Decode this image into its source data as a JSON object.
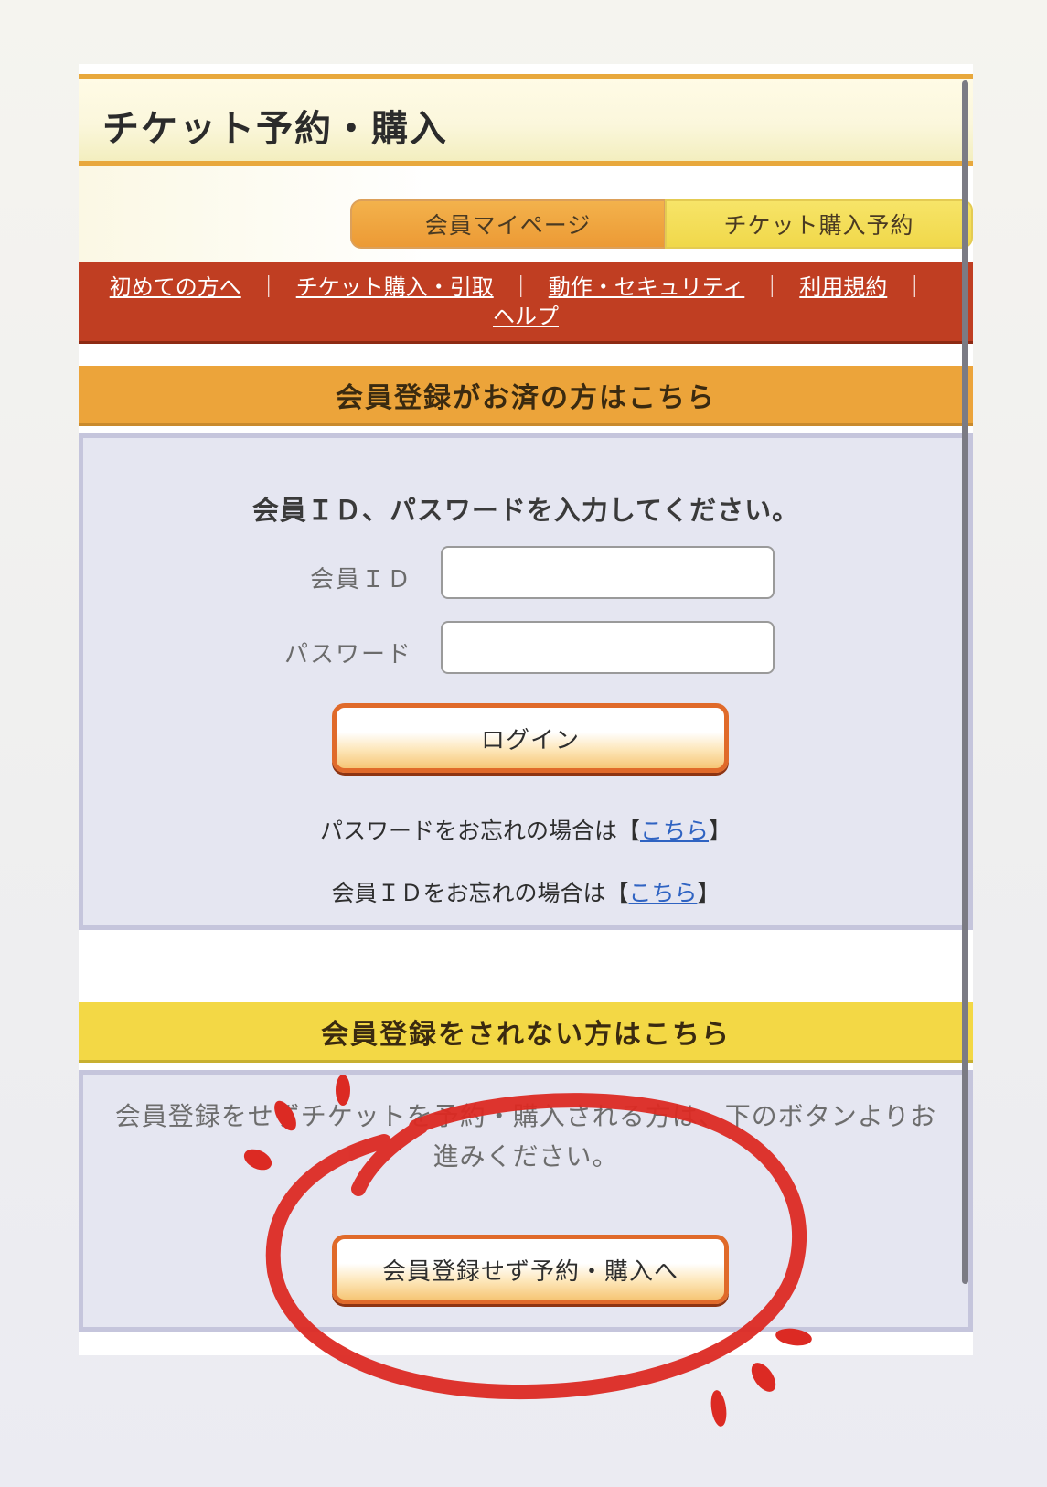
{
  "header": {
    "title": "チケット予約・購入"
  },
  "tabs": [
    {
      "label": "会員マイページ"
    },
    {
      "label": "チケット購入予約"
    }
  ],
  "nav": {
    "items": [
      "初めての方へ",
      "チケット購入・引取",
      "動作・セキュリティ",
      "利用規約",
      "ヘルプ"
    ],
    "separator": "｜"
  },
  "member_section": {
    "header": "会員登録がお済の方はこちら",
    "instruction": "会員ＩＤ、パスワードを入力してください。",
    "id_label": "会員ＩＤ",
    "password_label": "パスワード",
    "id_value": "",
    "password_value": "",
    "login_button": "ログイン",
    "forgot_password_prefix": "パスワードをお忘れの場合は【",
    "forgot_id_prefix": "会員ＩＤをお忘れの場合は【",
    "link_text": "こちら",
    "link_suffix": "】"
  },
  "guest_section": {
    "header": "会員登録をされない方はこちら",
    "description": "会員登録をせずチケットを予約・購入される方は、下のボタンよりお進みください。",
    "button": "会員登録せず予約・購入へ"
  },
  "colors": {
    "title_border": "#e8a83c",
    "nav_bg": "#c03e22",
    "header_orange": "#eca43a",
    "header_yellow": "#f3d845",
    "panel_bg": "#e5e6f1",
    "button_border": "#e06a2a",
    "link": "#2f63c2",
    "annotation": "#dc2a23"
  }
}
